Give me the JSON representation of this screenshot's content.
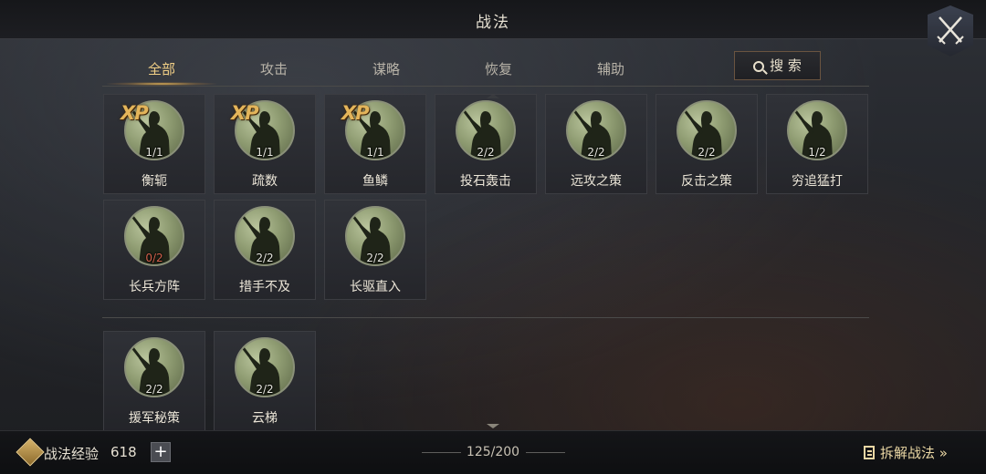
{
  "header": {
    "title": "战法"
  },
  "tabs": [
    {
      "label": "全部",
      "active": true
    },
    {
      "label": "攻击",
      "active": false
    },
    {
      "label": "谋略",
      "active": false
    },
    {
      "label": "恢复",
      "active": false
    },
    {
      "label": "辅助",
      "active": false
    }
  ],
  "search": {
    "label": "搜 索"
  },
  "cards_top": [
    {
      "name": "衡轭",
      "count": "1/1",
      "xp": "XP"
    },
    {
      "name": "疏数",
      "count": "1/1",
      "xp": "XP"
    },
    {
      "name": "鱼鳞",
      "count": "1/1",
      "xp": "XP"
    },
    {
      "name": "投石轰击",
      "count": "2/2"
    },
    {
      "name": "远攻之策",
      "count": "2/2"
    },
    {
      "name": "反击之策",
      "count": "2/2"
    },
    {
      "name": "穷追猛打",
      "count": "1/2"
    },
    {
      "name": "长兵方阵",
      "count": "0/2"
    },
    {
      "name": "措手不及",
      "count": "2/2"
    },
    {
      "name": "长驱直入",
      "count": "2/2"
    }
  ],
  "cards_bottom": [
    {
      "name": "援军秘策",
      "count": "2/2"
    },
    {
      "name": "云梯",
      "count": "2/2"
    }
  ],
  "footer": {
    "exp_label": "战法经验",
    "exp_value": "618",
    "add_label": "+",
    "page": "125/200",
    "dismantle_label": "拆解战法 »"
  },
  "colors": {
    "accent_gold": "#f1cf86",
    "zero_count": "#d2614c"
  }
}
